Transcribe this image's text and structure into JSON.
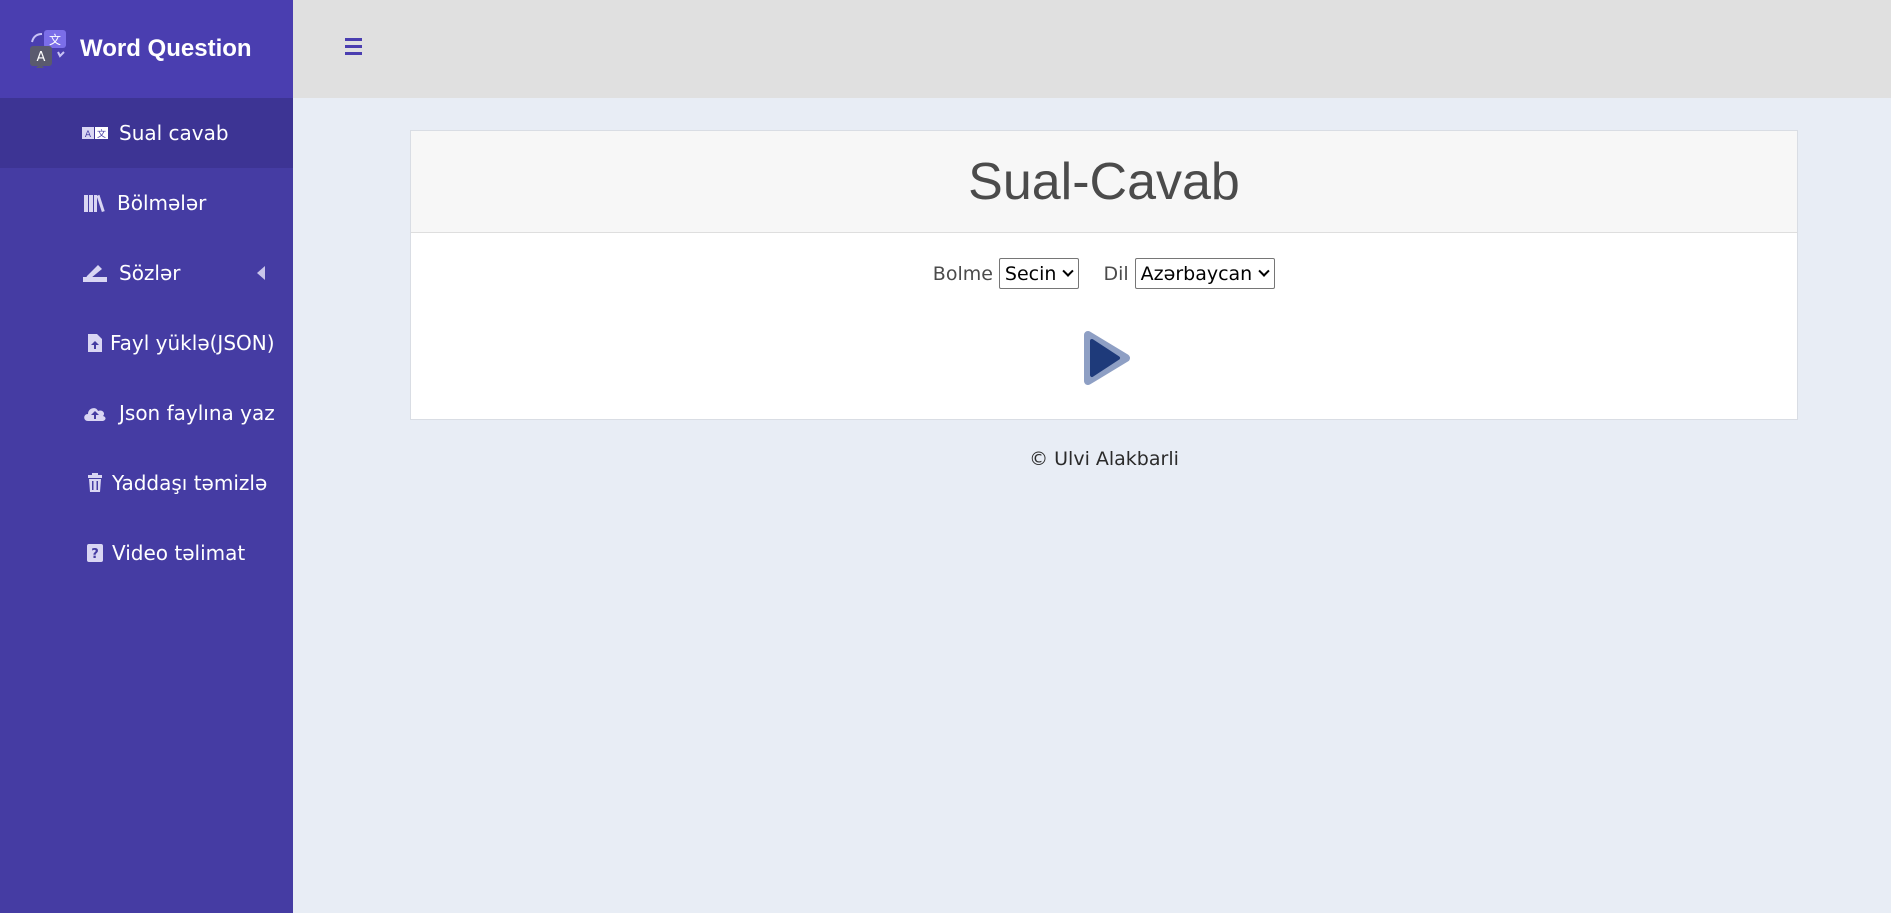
{
  "brand": {
    "name": "Word Question",
    "logo_icon": "translate-logo-icon"
  },
  "topbar": {
    "menu_icon": "hamburger-menu-icon"
  },
  "sidebar": {
    "items": [
      {
        "label": "Sual cavab",
        "icon": "translate-icon",
        "active": true
      },
      {
        "label": "Bölmələr",
        "icon": "books-icon"
      },
      {
        "label": "Sözlər",
        "icon": "pen-icon",
        "has_submenu": true
      },
      {
        "label": "Fayl yüklə(JSON)",
        "icon": "file-upload-icon"
      },
      {
        "label": "Json faylına yaz",
        "icon": "cloud-upload-icon"
      },
      {
        "label": "Yaddaşı təmizlə",
        "icon": "trash-icon"
      },
      {
        "label": "Video təlimat",
        "icon": "question-icon"
      }
    ]
  },
  "main": {
    "title": "Sual-Cavab",
    "section_label": "Bolme",
    "section_value": "Secin",
    "language_label": "Dil",
    "language_value": "Azərbaycan",
    "play_icon": "play-icon"
  },
  "footer": {
    "text": "© Ulvi Alakbarli"
  },
  "colors": {
    "sidebar": "#453ca3",
    "accent": "#4a3eb0",
    "play": "#1e3a7a",
    "background": "#e8edf5"
  }
}
